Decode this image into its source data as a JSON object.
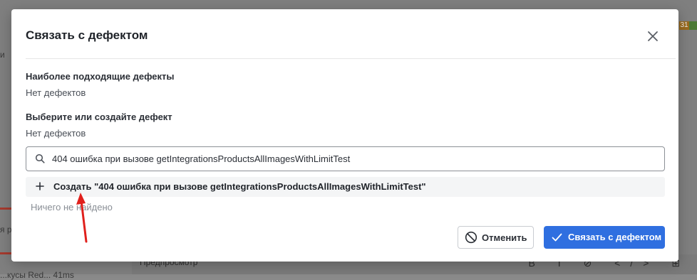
{
  "background": {
    "left_text_top": "и",
    "left_text_mid": "я р",
    "left_text_bottom": "...кусы Red... 41ms",
    "badge": "31",
    "preview_label": "Предпросмотр",
    "toolbar_glyphs": "B I ⊘ </> ⊞"
  },
  "dialog": {
    "title": "Связать с дефектом",
    "suggested": {
      "heading": "Наиболее подходящие дефекты",
      "empty": "Нет дефектов"
    },
    "select": {
      "heading": "Выберите или создайте дефект",
      "empty": "Нет дефектов"
    },
    "search": {
      "value": "404 ошибка при вызове getIntegrationsProductsAllImagesWithLimitTest",
      "placeholder": ""
    },
    "create_option": "Создать \"404 ошибка при вызове getIntegrationsProductsAllImagesWithLimitTest\"",
    "nothing_found": "Ничего не найдено",
    "buttons": {
      "cancel": "Отменить",
      "link": "Связать с дефектом"
    }
  },
  "colors": {
    "primary": "#2f6fe0",
    "annotation_arrow": "#e0201c"
  },
  "icons": [
    "close-icon",
    "search-icon",
    "plus-icon",
    "cancel-icon",
    "check-icon"
  ]
}
